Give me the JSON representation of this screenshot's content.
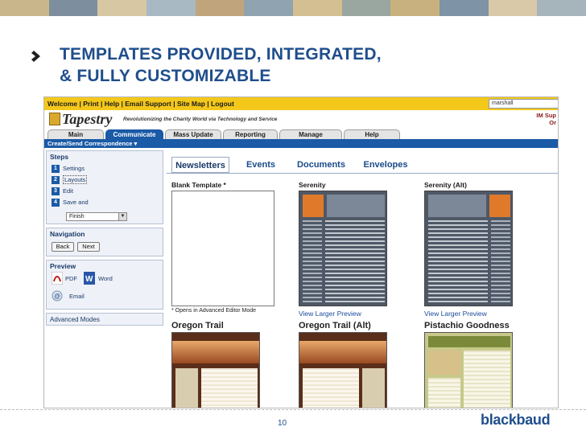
{
  "slide": {
    "title_line1": "TEMPLATES PROVIDED, INTEGRATED,",
    "title_line2": "& FULLY CUSTOMIZABLE",
    "page_number": "10",
    "brand": "blackbaud",
    "accent_color": "#1f4e8c"
  },
  "app": {
    "top_links": "Welcome | Print | Help | Email Support | Site Map | Logout",
    "user_field_value": "marshall",
    "logo_name": "Tapestry",
    "tagline": "Revolutionizing the Charity World via Technology and Service",
    "support_line1": "IM Sup",
    "support_line2": "Or",
    "tabs": [
      "Main",
      "Communicate",
      "Mass Update",
      "Reporting",
      "Manage",
      "Help"
    ],
    "active_tab": "Communicate",
    "subnav": "Create/Send Correspondence ▾",
    "colors": {
      "topbar": "#f3c81b",
      "nav": "#1a5aa6"
    }
  },
  "sidebar": {
    "steps_heading": "Steps",
    "steps": [
      {
        "num": "1",
        "label": "Settings"
      },
      {
        "num": "2",
        "label": "Layouts"
      },
      {
        "num": "3",
        "label": "Edit"
      },
      {
        "num": "4",
        "label": "Save and"
      }
    ],
    "finish_select": "Finish",
    "navigation_heading": "Navigation",
    "back_label": "Back",
    "next_label": "Next",
    "preview_heading": "Preview",
    "pdf_label": "PDF",
    "word_label": "Word",
    "email_label": "Email",
    "advanced_modes": "Advanced Modes"
  },
  "content": {
    "tabs": [
      "Newsletters",
      "Events",
      "Documents",
      "Envelopes"
    ],
    "active_tab": "Newsletters",
    "row1": {
      "blank_title": "Blank Template *",
      "blank_note": "* Opens in Advanced Editor Mode",
      "serenity_title": "Serenity",
      "serenity_alt_title": "Serenity (Alt)",
      "view_larger": "View Larger Preview"
    },
    "row2": {
      "t1": "Oregon Trail",
      "t2": "Oregon Trail (Alt)",
      "t3": "Pistachio Goodness"
    }
  }
}
